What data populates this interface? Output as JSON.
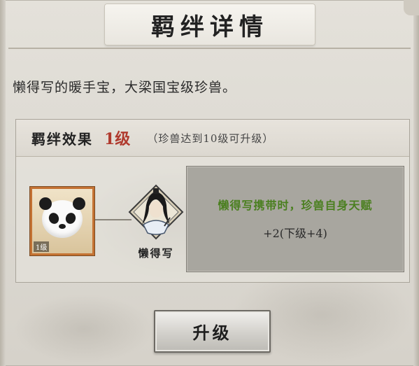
{
  "dialog": {
    "title": "羁绊详情",
    "description": "懒得写的暖手宝，大梁国宝级珍兽。"
  },
  "bond": {
    "effect_label": "羁绊效果",
    "level": "1级",
    "upgrade_hint": "（珍兽达到10级可升级）",
    "pet_card": {
      "level_badge": "1级",
      "icon": "panda-icon"
    },
    "character": {
      "name": "懒得写",
      "icon": "swordsman-portrait-icon"
    },
    "effect_line1": "懒得写携带时，珍兽自身天赋",
    "effect_line2": "+2(下级+4)"
  },
  "actions": {
    "upgrade_label": "升级"
  },
  "colors": {
    "level_red": "#b03a2e",
    "effect_green": "#4a7f1f",
    "pet_card_border": "#c47233"
  }
}
